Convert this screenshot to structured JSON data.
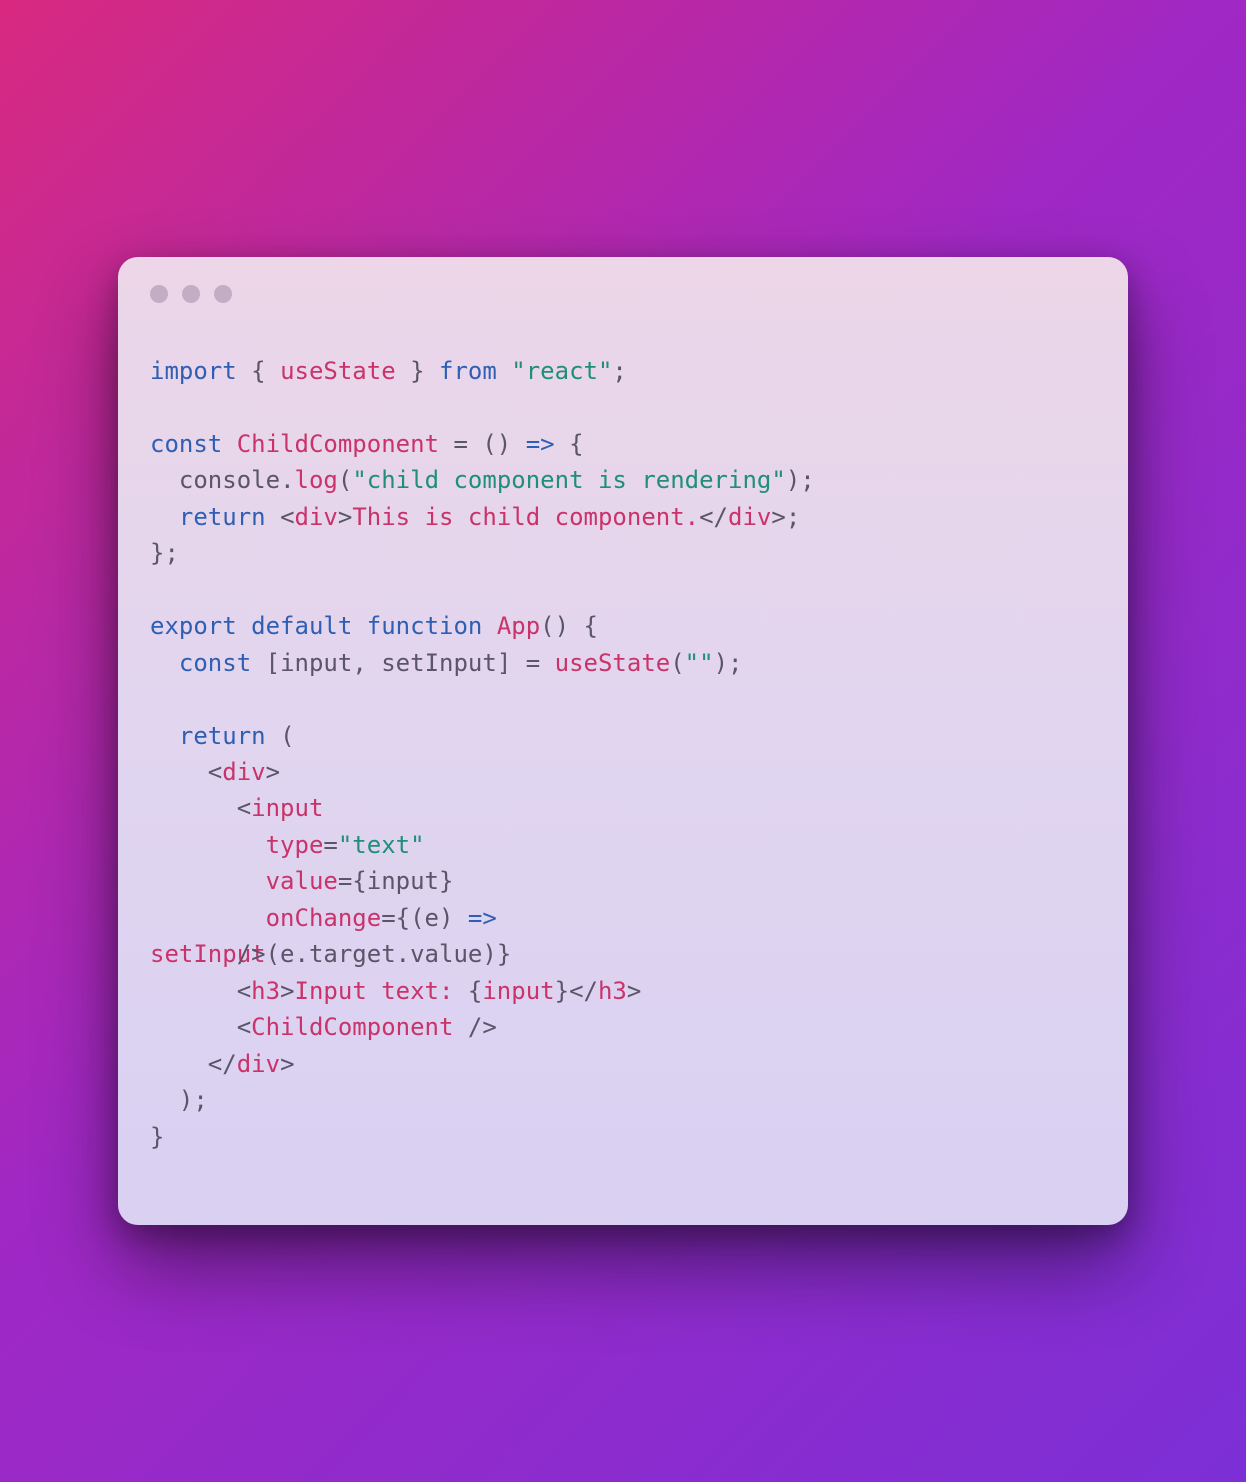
{
  "code": {
    "l1": {
      "import": "import",
      "lb": " { ",
      "useState": "useState",
      "rb": " } ",
      "from": "from",
      "sp": " ",
      "react": "\"react\"",
      "semi": ";"
    },
    "l2": "",
    "l3": {
      "const": "const",
      "sp1": " ",
      "name": "ChildComponent",
      "sp2": " ",
      "eq": "=",
      "sp3": " ",
      "paren": "()",
      "sp4": " ",
      "arrow": "=>",
      "sp5": " ",
      "brace": "{"
    },
    "l4": {
      "indent": "  ",
      "console": "console",
      "dot": ".",
      "log": "log",
      "lp": "(",
      "str": "\"child component is rendering\"",
      "rp": ")",
      "semi": ";"
    },
    "l5": {
      "indent": "  ",
      "return": "return",
      "sp": " ",
      "lt": "<",
      "tag": "div",
      "gt": ">",
      "text": "This is child component.",
      "lt2": "</",
      "tag2": "div",
      "gt2": ">",
      "semi": ";"
    },
    "l6": {
      "close": "};"
    },
    "l7": "",
    "l8": {
      "export": "export",
      "sp1": " ",
      "default": "default",
      "sp2": " ",
      "function": "function",
      "sp3": " ",
      "name": "App",
      "paren": "()",
      "sp4": " ",
      "brace": "{"
    },
    "l9": {
      "indent": "  ",
      "const": "const",
      "sp1": " ",
      "lb": "[",
      "input": "input",
      "comma": ", ",
      "setInput": "setInput",
      "rb": "]",
      "sp2": " ",
      "eq": "=",
      "sp3": " ",
      "useState": "useState",
      "lp": "(",
      "str": "\"\"",
      "rp": ")",
      "semi": ";"
    },
    "l10": "",
    "l11": {
      "indent": "  ",
      "return": "return",
      "sp": " ",
      "lp": "("
    },
    "l12": {
      "indent": "    ",
      "lt": "<",
      "tag": "div",
      "gt": ">"
    },
    "l13": {
      "indent": "      ",
      "lt": "<",
      "tag": "input"
    },
    "l14": {
      "indent": "        ",
      "attr": "type",
      "eq": "=",
      "val": "\"text\""
    },
    "l15": {
      "indent": "        ",
      "attr": "value",
      "eq": "=",
      "lb": "{",
      "var": "input",
      "rb": "}"
    },
    "l16": {
      "indent": "        ",
      "attr": "onChange",
      "eq": "=",
      "lb": "{",
      "lp": "(",
      "e": "e",
      "rp": ")",
      "sp": " ",
      "arrow": "=>"
    },
    "l17": {
      "setInput": "setInput",
      "lp": "(",
      "e": "e",
      "dot1": ".",
      "target": "target",
      "dot2": ".",
      "value": "value",
      "rp": ")",
      "rb": "}",
      "close": "/>",
      "indent_overlap": "      "
    },
    "l18": {
      "indent": "      ",
      "lt": "<",
      "tag": "h3",
      "gt": ">",
      "text": "Input text: ",
      "lb": "{",
      "var": "input",
      "rb": "}",
      "lt2": "</",
      "tag2": "h3",
      "gt2": ">"
    },
    "l19": {
      "indent": "      ",
      "lt": "<",
      "tag": "ChildComponent",
      "sp": " ",
      "close": "/>"
    },
    "l20": {
      "indent": "    ",
      "lt": "</",
      "tag": "div",
      "gt": ">"
    },
    "l21": {
      "indent": "  ",
      "rp": ");"
    },
    "l22": {
      "close": "}"
    }
  }
}
